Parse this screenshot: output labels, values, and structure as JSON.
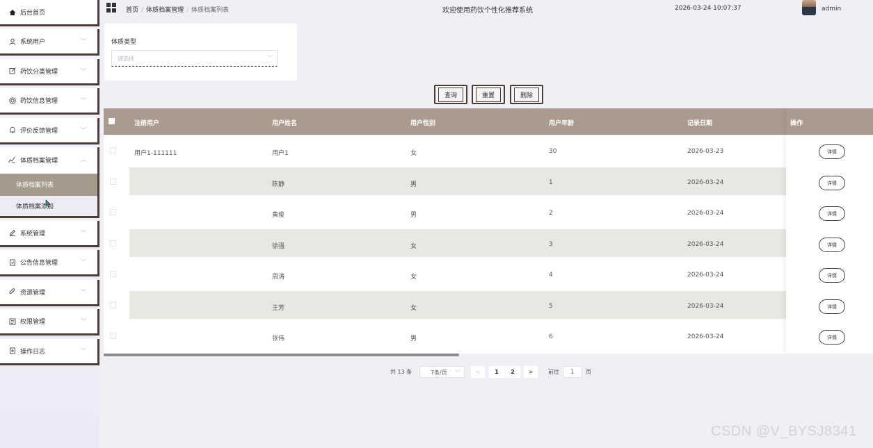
{
  "sidebar": {
    "home": {
      "label": "后台首页",
      "icon": "home-icon"
    },
    "items": [
      {
        "label": "系统用户",
        "icon": "user-icon"
      },
      {
        "label": "药饮分类管理",
        "icon": "edit-icon"
      },
      {
        "label": "药饮信息管理",
        "icon": "target-icon"
      },
      {
        "label": "评价反馈管理",
        "icon": "bell-icon"
      }
    ],
    "open_group": {
      "label": "体质档案管理",
      "icon": "chart-icon"
    },
    "sub_items": [
      {
        "label": "体质档案列表",
        "active": true
      },
      {
        "label": "体质档案添加",
        "active": false
      }
    ],
    "items_after": [
      {
        "label": "系统管理",
        "icon": "pen-icon"
      },
      {
        "label": "公告信息管理",
        "icon": "doc-icon"
      },
      {
        "label": "资源管理",
        "icon": "paperclip-icon"
      },
      {
        "label": "权限管理",
        "icon": "list-icon"
      },
      {
        "label": "操作日志",
        "icon": "log-icon"
      }
    ]
  },
  "header": {
    "breadcrumb": [
      "首页",
      "体质档案管理",
      "体质档案列表"
    ],
    "system_title": "欢迎使用药饮个性化推荐系统",
    "datetime": "2026-03-24 10:07:37",
    "username": "admin"
  },
  "search": {
    "field_label": "体质类型",
    "placeholder": "请选择",
    "buttons": {
      "query": "查询",
      "reset": "重置",
      "delete": "删除"
    }
  },
  "table": {
    "columns": [
      "注册用户",
      "用户姓名",
      "用户性别",
      "用户年龄",
      "记录日期",
      "操作"
    ],
    "rows": [
      {
        "user": "用户1-111111",
        "name": "用户1",
        "gender": "女",
        "age": "30",
        "date": "2026-03-23",
        "action": "详情"
      },
      {
        "user": "",
        "name": "陈静",
        "gender": "男",
        "age": "1",
        "date": "2026-03-24",
        "action": "详情"
      },
      {
        "user": "",
        "name": "黄俊",
        "gender": "男",
        "age": "2",
        "date": "2026-03-24",
        "action": "详情"
      },
      {
        "user": "",
        "name": "徐强",
        "gender": "女",
        "age": "3",
        "date": "2026-03-24",
        "action": "详情"
      },
      {
        "user": "",
        "name": "周涛",
        "gender": "女",
        "age": "4",
        "date": "2026-03-24",
        "action": "详情"
      },
      {
        "user": "",
        "name": "王芳",
        "gender": "女",
        "age": "5",
        "date": "2026-03-24",
        "action": "详情"
      },
      {
        "user": "",
        "name": "张伟",
        "gender": "男",
        "age": "6",
        "date": "2026-03-24",
        "action": "详情"
      }
    ]
  },
  "pagination": {
    "total": "共 13 条",
    "page_size": "7条/页",
    "pages": [
      "1",
      "2"
    ],
    "goto_label": "前往",
    "goto_value": "1",
    "page_unit": "页"
  },
  "watermark": "CSDN @V_BYSJ8341",
  "colors": {
    "accent": "#a99b8d",
    "border": "#4a3b34",
    "active_menu": "#a69a8c"
  }
}
